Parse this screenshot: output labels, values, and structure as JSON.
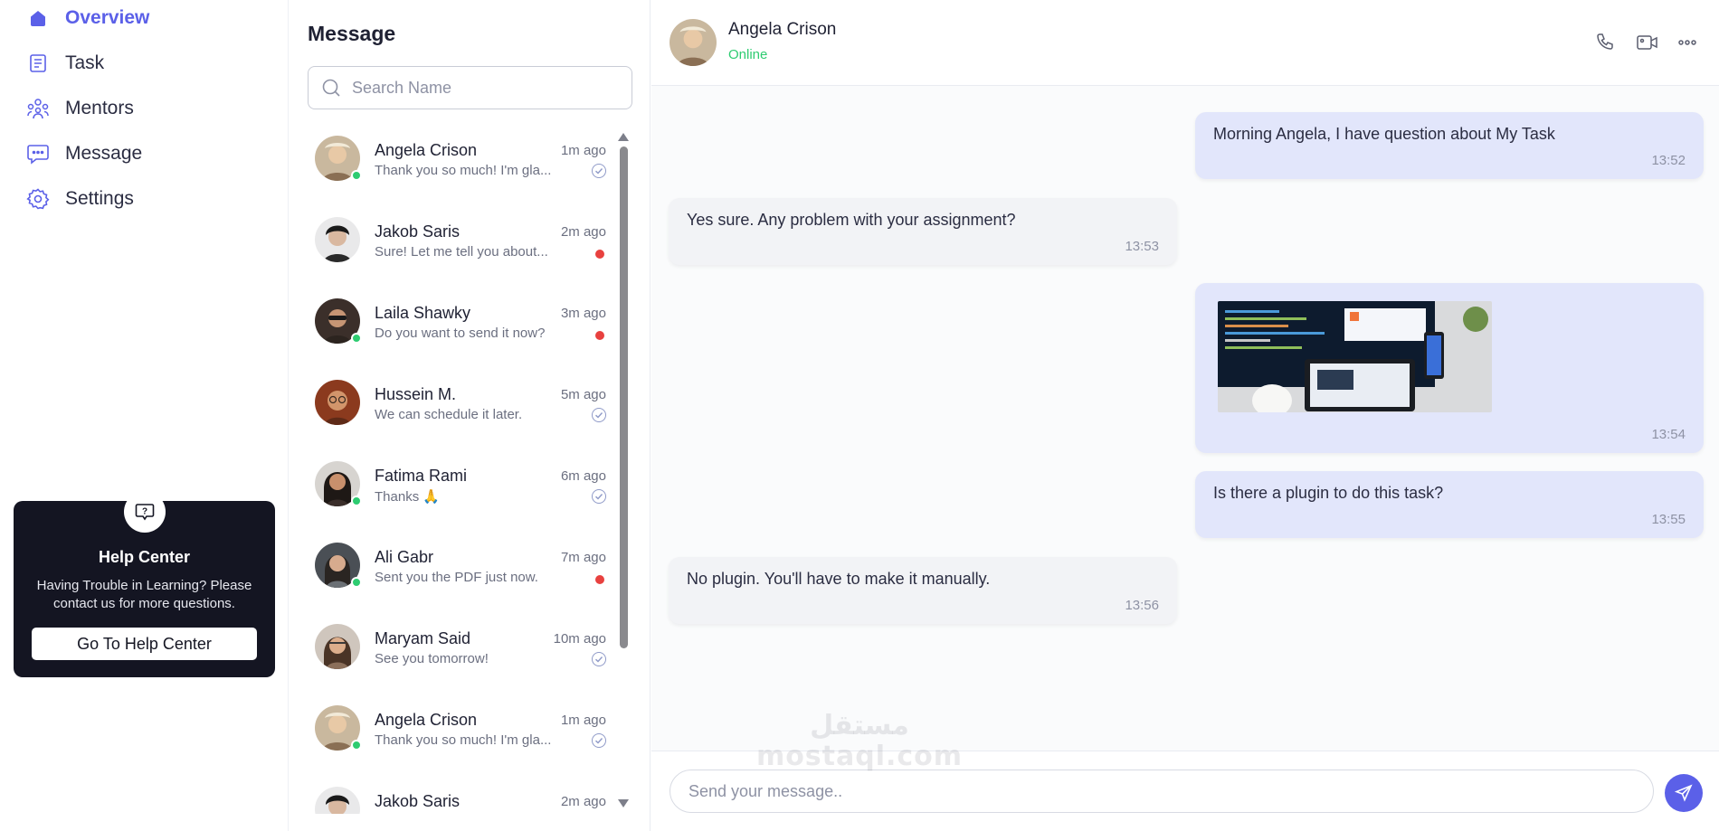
{
  "sidebar": {
    "nav": [
      {
        "label": "Overview",
        "icon": "home-icon",
        "active": true
      },
      {
        "label": "Task",
        "icon": "task-icon",
        "active": false
      },
      {
        "label": "Mentors",
        "icon": "mentors-icon",
        "active": false
      },
      {
        "label": "Message",
        "icon": "message-icon",
        "active": false
      },
      {
        "label": "Settings",
        "icon": "settings-icon",
        "active": false
      }
    ],
    "help": {
      "title": "Help Center",
      "text": "Having Trouble in Learning? Please contact us for more questions.",
      "button": "Go To Help Center"
    }
  },
  "messages": {
    "title": "Message",
    "search_placeholder": "Search Name",
    "conversations": [
      {
        "name": "Angela Crison",
        "time": "1m ago",
        "preview": "Thank you so much! I'm gla...",
        "online": true,
        "status": "read"
      },
      {
        "name": "Jakob Saris",
        "time": "2m ago",
        "preview": "Sure! Let me tell you about...",
        "online": false,
        "status": "unread"
      },
      {
        "name": "Laila Shawky",
        "time": "3m ago",
        "preview": "Do you want to send it now?",
        "online": true,
        "status": "unread"
      },
      {
        "name": "Hussein M.",
        "time": "5m ago",
        "preview": "We can schedule it later.",
        "online": false,
        "status": "read"
      },
      {
        "name": "Fatima Rami",
        "time": "6m ago",
        "preview": "Thanks 🙏",
        "online": true,
        "status": "read"
      },
      {
        "name": "Ali Gabr",
        "time": "7m ago",
        "preview": "Sent you the PDF just now.",
        "online": true,
        "status": "unread"
      },
      {
        "name": "Maryam Said",
        "time": "10m ago",
        "preview": "See you tomorrow!",
        "online": false,
        "status": "read"
      },
      {
        "name": "Angela Crison",
        "time": "1m ago",
        "preview": "Thank you so much! I'm gla...",
        "online": true,
        "status": "read"
      },
      {
        "name": "Jakob Saris",
        "time": "2m ago",
        "preview": "",
        "online": false,
        "status": "none"
      }
    ]
  },
  "chat": {
    "name": "Angela Crison",
    "status": "Online",
    "messages": [
      {
        "dir": "out",
        "text": "Morning Angela, I have question about My Task",
        "time": "13:52"
      },
      {
        "dir": "in",
        "text": "Yes sure. Any problem with your assignment?",
        "time": "13:53"
      },
      {
        "dir": "out",
        "text": "",
        "image": true,
        "time": "13:54"
      },
      {
        "dir": "out",
        "text": "Is there a plugin to do this task?",
        "time": "13:55"
      },
      {
        "dir": "in",
        "text": "No plugin. You'll have to make it manually.",
        "time": "13:56"
      }
    ],
    "composer_placeholder": "Send your message..",
    "colors": {
      "accent": "#5b60e8",
      "online": "#2ecc71",
      "unread": "#e8413f",
      "outgoing_bubble": "#e2e6fb"
    }
  },
  "watermark": {
    "arabic": "مستقل",
    "latin": "mostaql.com"
  }
}
